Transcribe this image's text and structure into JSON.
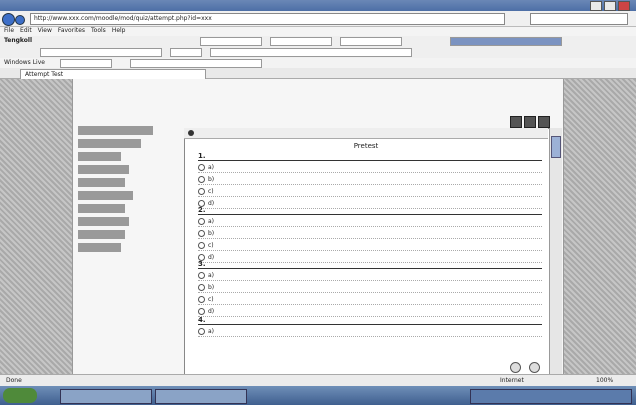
{
  "address": {
    "url": "http://www.xxx.com/moodle/mod/quiz/attempt.php?id=xxx"
  },
  "menu": [
    "File",
    "Edit",
    "View",
    "Favorites",
    "Tools",
    "Help"
  ],
  "toolbar": {
    "brand": "Tengkoll",
    "custom_label": "Windows Live"
  },
  "tab": {
    "label": "Attempt Test"
  },
  "sidebar": {
    "items": [
      "",
      "",
      "",
      "",
      "",
      "",
      "",
      "",
      "",
      ""
    ]
  },
  "panel": {
    "header": "",
    "title": "Pretest"
  },
  "questions": [
    {
      "title": "1.",
      "options": [
        "a)",
        "b)",
        "c)",
        "d)"
      ]
    },
    {
      "title": "2.",
      "options": [
        "a)",
        "b)",
        "c)",
        "d)"
      ]
    },
    {
      "title": "3.",
      "options": [
        "a)",
        "b)",
        "c)",
        "d)"
      ]
    },
    {
      "title": "4.",
      "options": [
        "a)"
      ]
    }
  ],
  "status": {
    "left": "Done",
    "zone": "Internet",
    "zoom": "100%"
  }
}
